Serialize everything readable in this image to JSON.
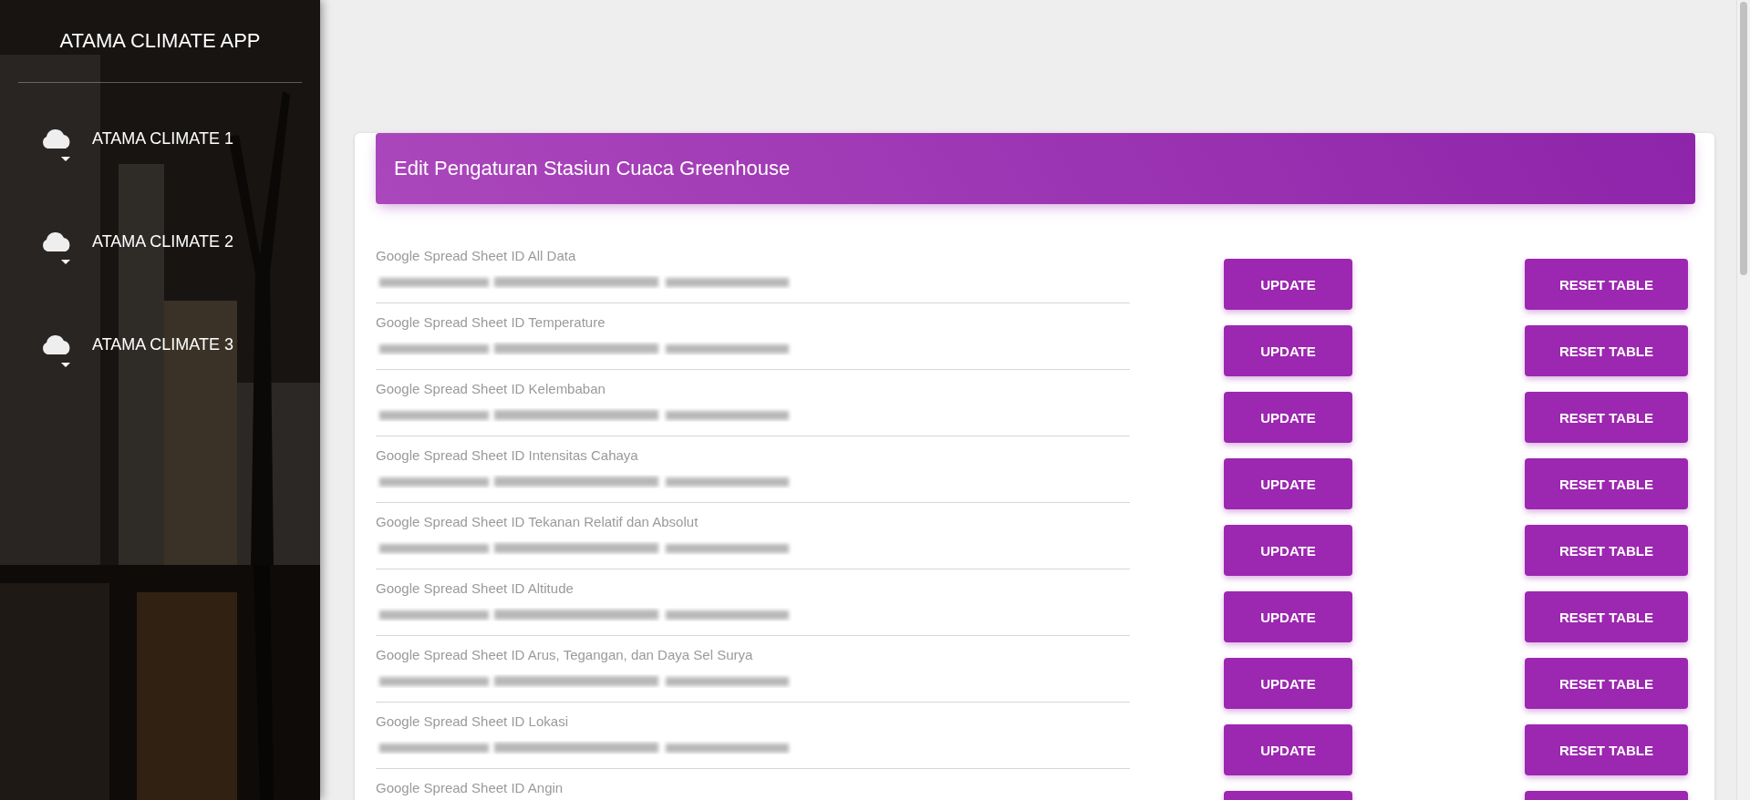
{
  "sidebar": {
    "title": "ATAMA CLIMATE APP",
    "items": [
      {
        "label": "ATAMA CLIMATE 1"
      },
      {
        "label": "ATAMA CLIMATE 2"
      },
      {
        "label": "ATAMA CLIMATE 3"
      }
    ]
  },
  "card": {
    "title": "Edit Pengaturan Stasiun Cuaca Greenhouse",
    "rows": [
      {
        "label": "Google Spread Sheet ID All Data",
        "blurred": true,
        "update": "UPDATE",
        "reset": "RESET TABLE"
      },
      {
        "label": "Google Spread Sheet ID Temperature",
        "blurred": true,
        "update": "UPDATE",
        "reset": "RESET TABLE"
      },
      {
        "label": "Google Spread Sheet ID Kelembaban",
        "blurred": true,
        "update": "UPDATE",
        "reset": "RESET TABLE"
      },
      {
        "label": "Google Spread Sheet ID Intensitas Cahaya",
        "blurred": true,
        "update": "UPDATE",
        "reset": "RESET TABLE"
      },
      {
        "label": "Google Spread Sheet ID Tekanan Relatif dan Absolut",
        "blurred": true,
        "update": "UPDATE",
        "reset": "RESET TABLE"
      },
      {
        "label": "Google Spread Sheet ID Altitude",
        "blurred": true,
        "update": "UPDATE",
        "reset": "RESET TABLE"
      },
      {
        "label": "Google Spread Sheet ID Arus, Tegangan, dan Daya Sel Surya",
        "blurred": true,
        "update": "UPDATE",
        "reset": "RESET TABLE"
      },
      {
        "label": "Google Spread Sheet ID Lokasi",
        "blurred": true,
        "update": "UPDATE",
        "reset": "RESET TABLE"
      },
      {
        "label": "Google Spread Sheet ID Angin",
        "blurred": false
      }
    ]
  }
}
